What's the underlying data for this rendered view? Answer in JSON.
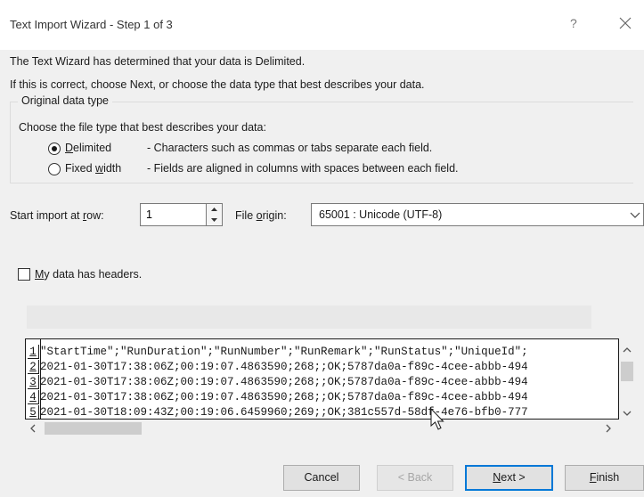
{
  "window": {
    "title": "Text Import Wizard - Step 1 of 3",
    "help_glyph": "?"
  },
  "intro": {
    "line1": "The Text Wizard has determined that your data is Delimited.",
    "line2": "If this is correct, choose Next, or choose the data type that best describes your data."
  },
  "original_data_type": {
    "legend": "Original data type",
    "choose_label": "Choose the file type that best describes your data:",
    "options": [
      {
        "label_accel": "D",
        "label_rest": "elimited",
        "description": "- Characters such as commas or tabs separate each field.",
        "selected": true
      },
      {
        "label_pre": "Fixed ",
        "label_accel": "w",
        "label_rest": "idth",
        "description": "- Fields are aligned in columns with spaces between each field.",
        "selected": false
      }
    ]
  },
  "import_settings": {
    "start_row_label_pre": "Start import at ",
    "start_row_label_accel": "r",
    "start_row_label_rest": "ow:",
    "start_row_value": "1",
    "file_origin_label_pre": "File ",
    "file_origin_label_accel": "o",
    "file_origin_label_rest": "rigin:",
    "file_origin_value": "65001 : Unicode (UTF-8)"
  },
  "headers_checkbox": {
    "label_accel": "M",
    "label_rest": "y data has headers.",
    "checked": false
  },
  "preview": {
    "rows": [
      {
        "num": "1",
        "text": "\"StartTime\";\"RunDuration\";\"RunNumber\";\"RunRemark\";\"RunStatus\";\"UniqueId\";"
      },
      {
        "num": "2",
        "text": "2021-01-30T17:38:06Z;00:19:07.4863590;268;;OK;5787da0a-f89c-4cee-abbb-494"
      },
      {
        "num": "3",
        "text": "2021-01-30T17:38:06Z;00:19:07.4863590;268;;OK;5787da0a-f89c-4cee-abbb-494"
      },
      {
        "num": "4",
        "text": "2021-01-30T17:38:06Z;00:19:07.4863590;268;;OK;5787da0a-f89c-4cee-abbb-494"
      },
      {
        "num": "5",
        "text": "2021-01-30T18:09:43Z;00:19:06.6459960;269;;OK;381c557d-58df-4e76-bfb0-777"
      }
    ]
  },
  "buttons": {
    "cancel": "Cancel",
    "back": "< Back",
    "next_accel": "N",
    "next_rest": "ext >",
    "finish_accel": "F",
    "finish_rest": "inish"
  },
  "colors": {
    "dialog_bg": "#f0f0f0",
    "titlebar_bg": "#ffffff",
    "focus_border": "#0078d7"
  }
}
